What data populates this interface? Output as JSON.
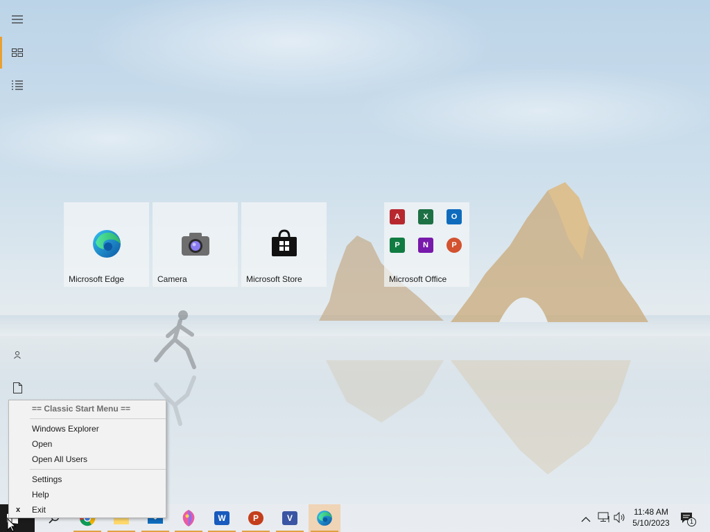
{
  "sidebar": {
    "items": [
      {
        "icon": "hamburger-menu-icon"
      },
      {
        "icon": "tiles-view-icon"
      },
      {
        "icon": "list-view-icon"
      },
      {
        "icon": "user-icon"
      },
      {
        "icon": "document-icon"
      }
    ],
    "accent_color": "#e8a030"
  },
  "tiles": [
    {
      "label": "Microsoft Edge",
      "icon": "edge-icon"
    },
    {
      "label": "Camera",
      "icon": "camera-icon"
    },
    {
      "label": "Microsoft Store",
      "icon": "store-icon"
    },
    {
      "label": "Microsoft Office",
      "icon": "office-group-icon",
      "apps": [
        {
          "letter": "A",
          "color": "#b7282e"
        },
        {
          "letter": "X",
          "color": "#1d7044"
        },
        {
          "letter": "O",
          "color": "#0f6cbd"
        },
        {
          "letter": "P",
          "color": "#107c41"
        },
        {
          "letter": "N",
          "color": "#7719aa"
        },
        {
          "letter": "P",
          "color": "#d35230"
        }
      ]
    }
  ],
  "context_menu": {
    "header": "== Classic Start Menu ==",
    "items": [
      "Windows Explorer",
      "Open",
      "Open All Users",
      "Settings",
      "Help",
      "Exit"
    ],
    "exit_mark": "x"
  },
  "taskbar": {
    "apps": [
      {
        "icon": "search-icon"
      },
      {
        "icon": "chrome-icon"
      },
      {
        "icon": "file-explorer-icon"
      },
      {
        "icon": "mail-icon"
      },
      {
        "icon": "paint-icon"
      },
      {
        "icon": "word-icon",
        "letter": "W",
        "color": "#185abd"
      },
      {
        "icon": "powerpoint-icon",
        "letter": "P",
        "color": "#c43e1c"
      },
      {
        "icon": "visio-icon",
        "letter": "V",
        "color": "#3955a3"
      },
      {
        "icon": "edge-icon"
      }
    ],
    "tray": {
      "time": "11:48 AM",
      "date": "5/10/2023",
      "notification_count": "1"
    }
  }
}
